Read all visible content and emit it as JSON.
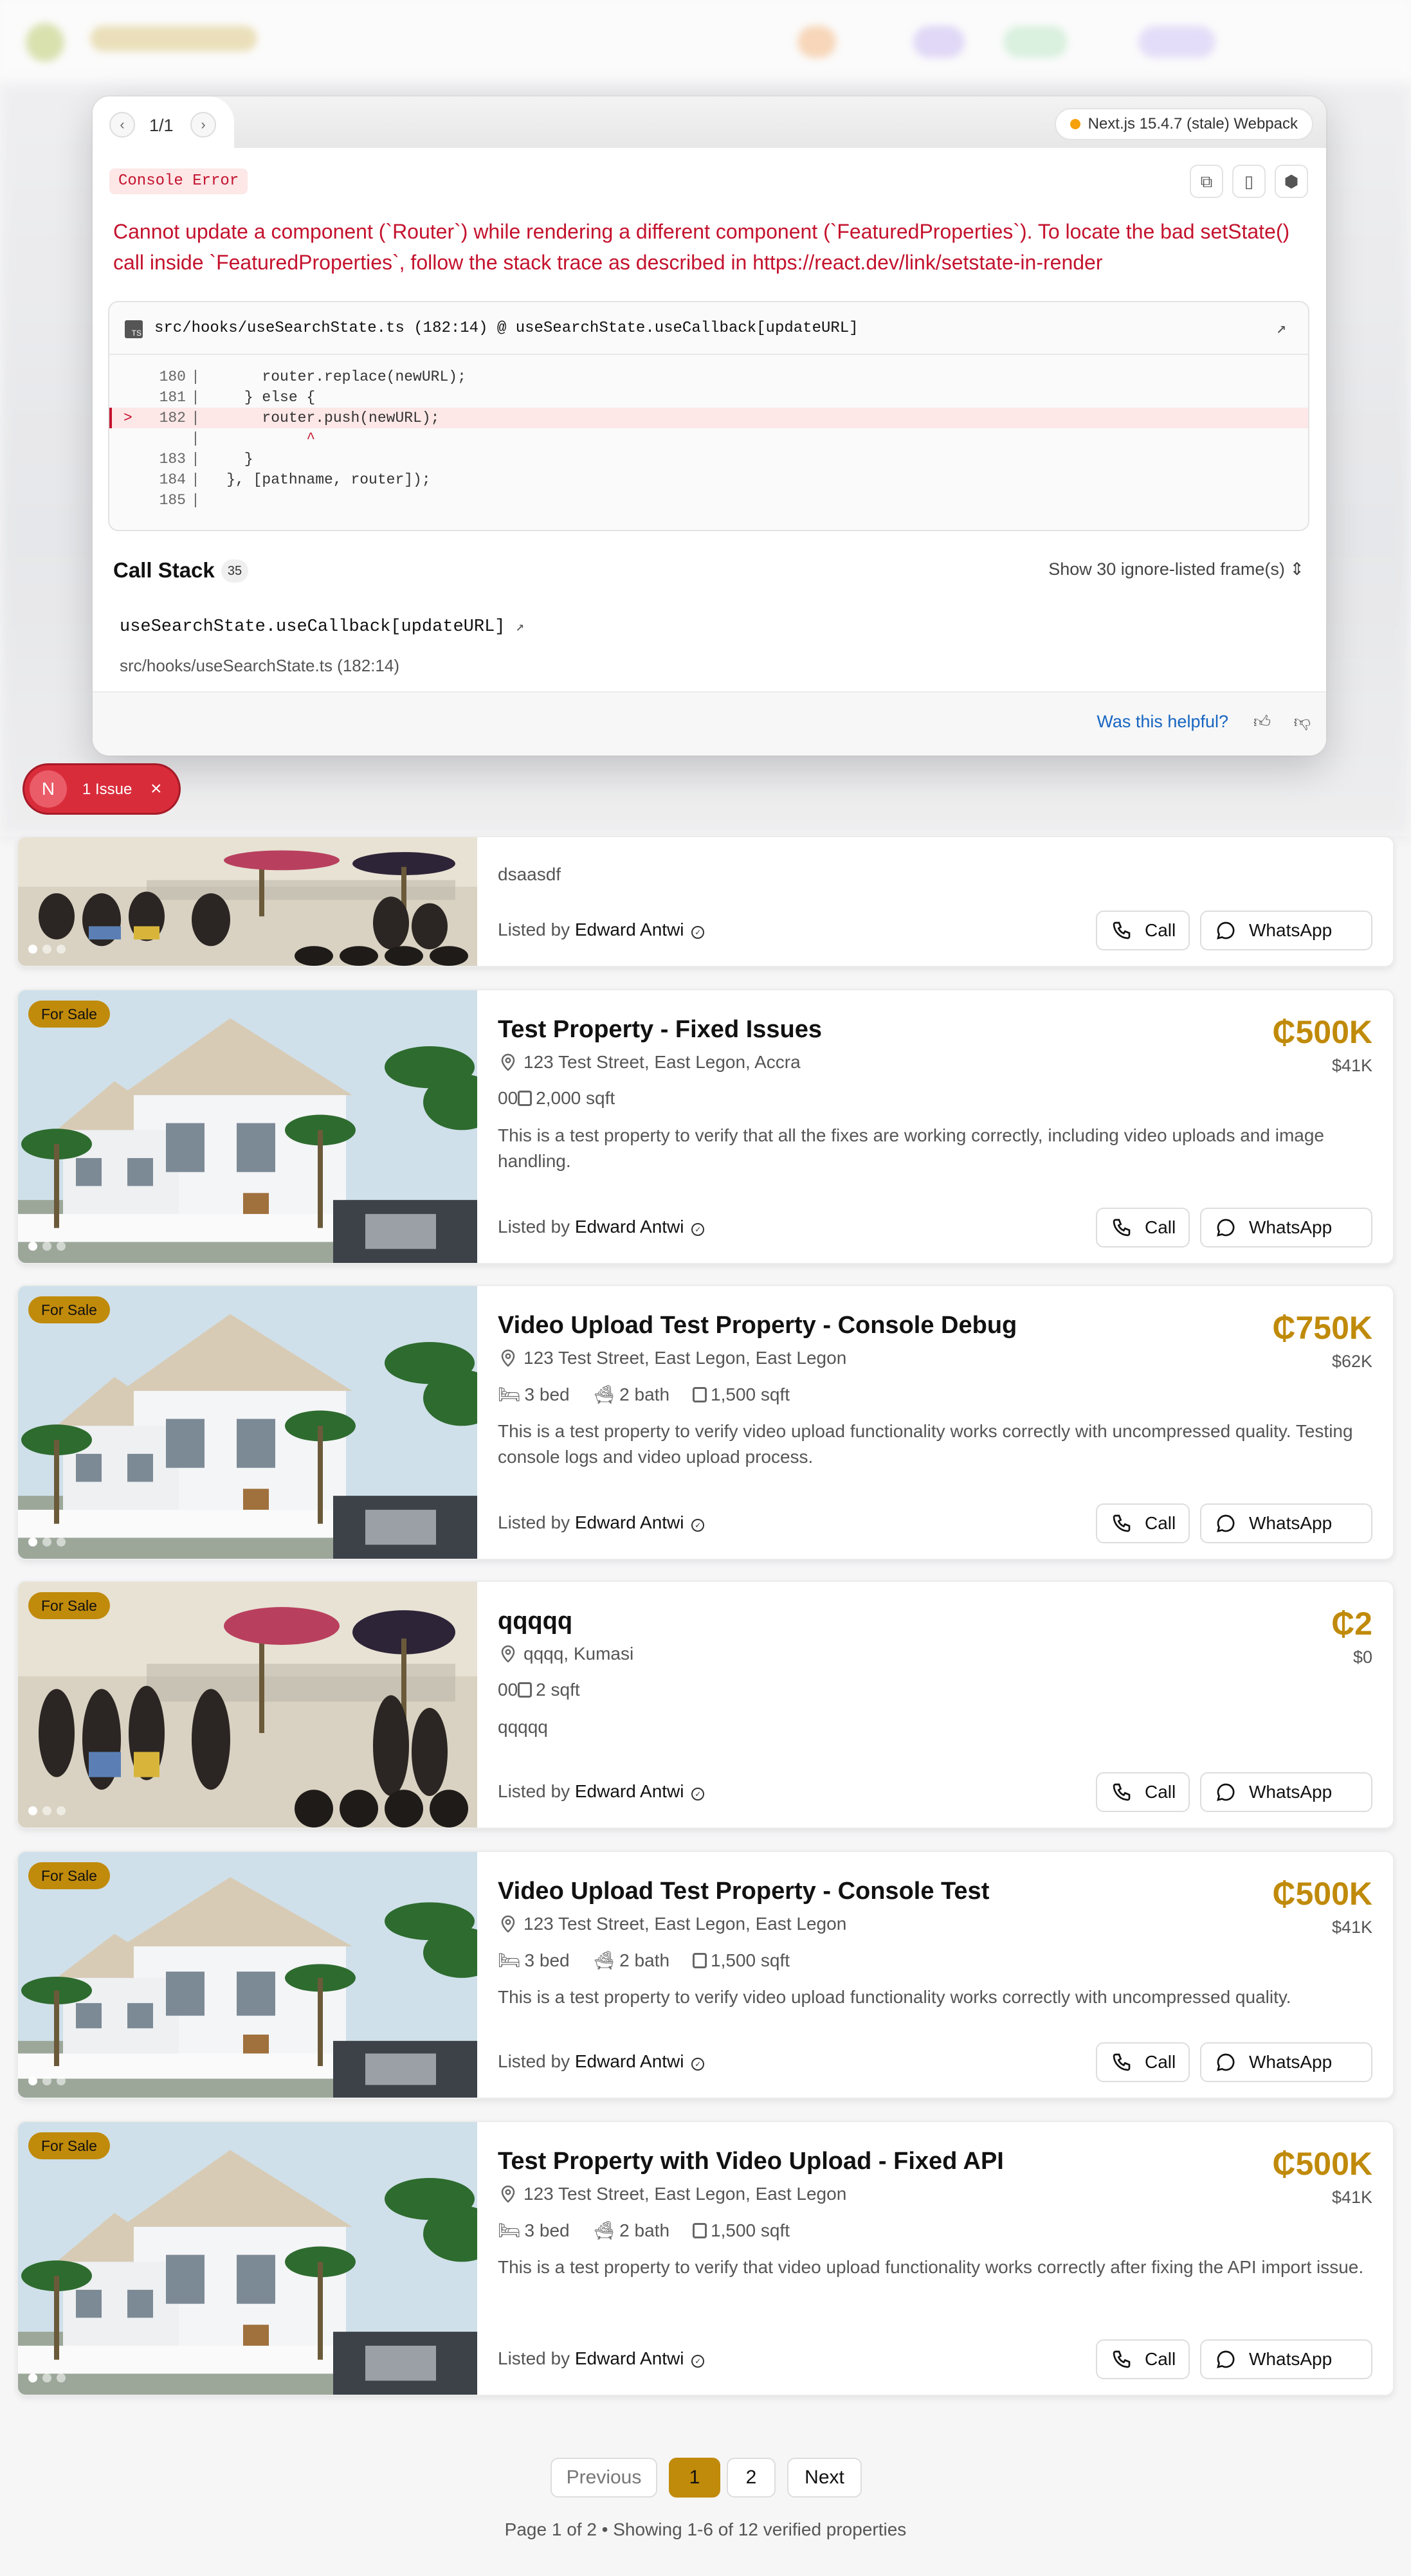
{
  "error_overlay": {
    "counter": "1/1",
    "version_badge": "Next.js 15.4.7 (stale) Webpack",
    "error_type": "Console Error",
    "message": "Cannot update a component (`Router`) while rendering a different component (`FeaturedProperties`). To locate the bad setState() call inside `FeaturedProperties`, follow the stack trace as described in https://react.dev/link/setstate-in-render",
    "code_frame": {
      "file": "src/hooks/useSearchState.ts (182:14) @ useSearchState.useCallback[updateURL]",
      "lines": [
        {
          "num": "180",
          "code": "      router.replace(newURL);"
        },
        {
          "num": "181",
          "code": "    } else {"
        },
        {
          "num": "182",
          "code": "      router.push(newURL);",
          "highlight": true
        },
        {
          "num": "",
          "code": "           ^"
        },
        {
          "num": "183",
          "code": "    }"
        },
        {
          "num": "184",
          "code": "  }, [pathname, router]);"
        },
        {
          "num": "185",
          "code": ""
        }
      ]
    },
    "call_stack": {
      "title": "Call Stack",
      "count": "35",
      "ignore_toggle": "Show 30 ignore-listed frame(s)",
      "frame_function": "useSearchState.useCallback[updateURL]",
      "frame_location": "src/hooks/useSearchState.ts (182:14)"
    },
    "footer": {
      "helpful": "Was this helpful?"
    }
  },
  "issues_pill": {
    "logo": "N",
    "label": "1 Issue"
  },
  "listings": [
    {
      "badge": "",
      "title": "",
      "price": "",
      "usd": "",
      "location": "",
      "features": "",
      "description": "dsaasdf",
      "listed_by_label": "Listed by",
      "agent": "Edward Antwi",
      "call": "Call",
      "whatsapp": "WhatsApp",
      "image": "painting"
    },
    {
      "badge": "For Sale",
      "title": "Test Property - Fixed Issues",
      "price": "₵500K",
      "usd": "$41K",
      "location": "123 Test Street, East Legon, Accra",
      "bed": "",
      "bath": "",
      "sqft": "2,000 sqft",
      "features_prefix": "00",
      "description": "This is a test property to verify that all the fixes are working correctly, including video uploads and image handling.",
      "listed_by_label": "Listed by",
      "agent": "Edward Antwi",
      "call": "Call",
      "whatsapp": "WhatsApp",
      "image": "house"
    },
    {
      "badge": "For Sale",
      "title": "Video Upload Test Property - Console Debug",
      "price": "₵750K",
      "usd": "$62K",
      "location": "123 Test Street, East Legon, East Legon",
      "bed": "3 bed",
      "bath": "2 bath",
      "sqft": "1,500 sqft",
      "description": "This is a test property to verify video upload functionality works correctly with uncompressed quality. Testing console logs and video upload process.",
      "listed_by_label": "Listed by",
      "agent": "Edward Antwi",
      "call": "Call",
      "whatsapp": "WhatsApp",
      "image": "house"
    },
    {
      "badge": "For Sale",
      "title": "qqqqq",
      "price": "₵2",
      "usd": "$0",
      "location": "qqqq, Kumasi",
      "bed": "",
      "bath": "",
      "sqft": "2 sqft",
      "features_prefix": "00",
      "description": "qqqqq",
      "listed_by_label": "Listed by",
      "agent": "Edward Antwi",
      "call": "Call",
      "whatsapp": "WhatsApp",
      "image": "painting"
    },
    {
      "badge": "For Sale",
      "title": "Video Upload Test Property - Console Test",
      "price": "₵500K",
      "usd": "$41K",
      "location": "123 Test Street, East Legon, East Legon",
      "bed": "3 bed",
      "bath": "2 bath",
      "sqft": "1,500 sqft",
      "description": "This is a test property to verify video upload functionality works correctly with uncompressed quality.",
      "listed_by_label": "Listed by",
      "agent": "Edward Antwi",
      "call": "Call",
      "whatsapp": "WhatsApp",
      "image": "house"
    },
    {
      "badge": "For Sale",
      "title": "Test Property with Video Upload - Fixed API",
      "price": "₵500K",
      "usd": "$41K",
      "location": "123 Test Street, East Legon, East Legon",
      "bed": "3 bed",
      "bath": "2 bath",
      "sqft": "1,500 sqft",
      "description": "This is a test property to verify that video upload functionality works correctly after fixing the API import issue.",
      "listed_by_label": "Listed by",
      "agent": "Edward Antwi",
      "call": "Call",
      "whatsapp": "WhatsApp",
      "image": "house"
    }
  ],
  "pagination": {
    "previous": "Previous",
    "page1": "1",
    "page2": "2",
    "next": "Next",
    "info": "Page 1 of 2 • Showing 1-6 of 12 verified properties"
  },
  "colors": {
    "accent": "#c08a0a",
    "error": "#c4122d"
  }
}
